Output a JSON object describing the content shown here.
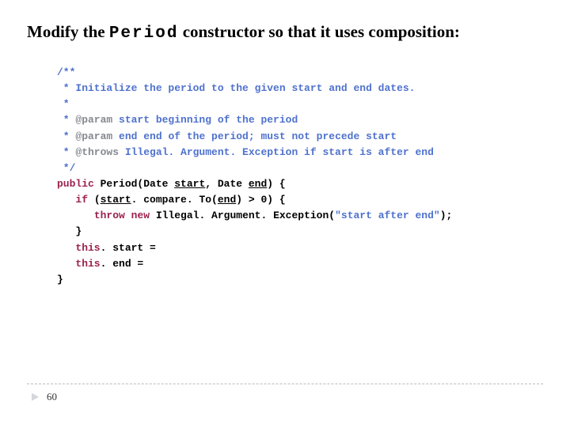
{
  "title": {
    "pre": "Modify the ",
    "code": "Period",
    "post": " constructor so that it uses composition:"
  },
  "code": {
    "c01": "/**",
    "c02_a": " * ",
    "c02_b": "Initialize the period to the given start and end dates.",
    "c03": " *",
    "c04_a": " * ",
    "c04_tag": "@param",
    "c04_b": " start ",
    "c04_c": "beginning of the period",
    "c05_a": " * ",
    "c05_tag": "@param",
    "c05_b": " end ",
    "c05_c": "end of the period; must not precede start",
    "c06_a": " * ",
    "c06_tag": "@throws",
    "c06_b": " Illegal. Argument. Exception if start is after end",
    "c07": " */",
    "c08_a": "public",
    "c08_b": " Period(Date ",
    "c08_c": "start",
    "c08_d": ", Date ",
    "c08_e": "end",
    "c08_f": ") {",
    "c09_a": "   ",
    "c09_b": "if",
    "c09_c": " (",
    "c09_d": "start",
    "c09_e": ". compare. To(",
    "c09_f": "end",
    "c09_g": ") > 0) {",
    "c10_a": "      ",
    "c10_b": "throw",
    "c10_c": " ",
    "c10_d": "new",
    "c10_e": " Illegal. Argument. Exception(",
    "c10_f": "\"start after end\"",
    "c10_g": ");",
    "c11": "   }",
    "c12_a": "   ",
    "c12_b": "this",
    "c12_c": ". start = ",
    "c13_a": "   ",
    "c13_b": "this",
    "c13_c": ". end = ",
    "c14": "}"
  },
  "page": "60"
}
